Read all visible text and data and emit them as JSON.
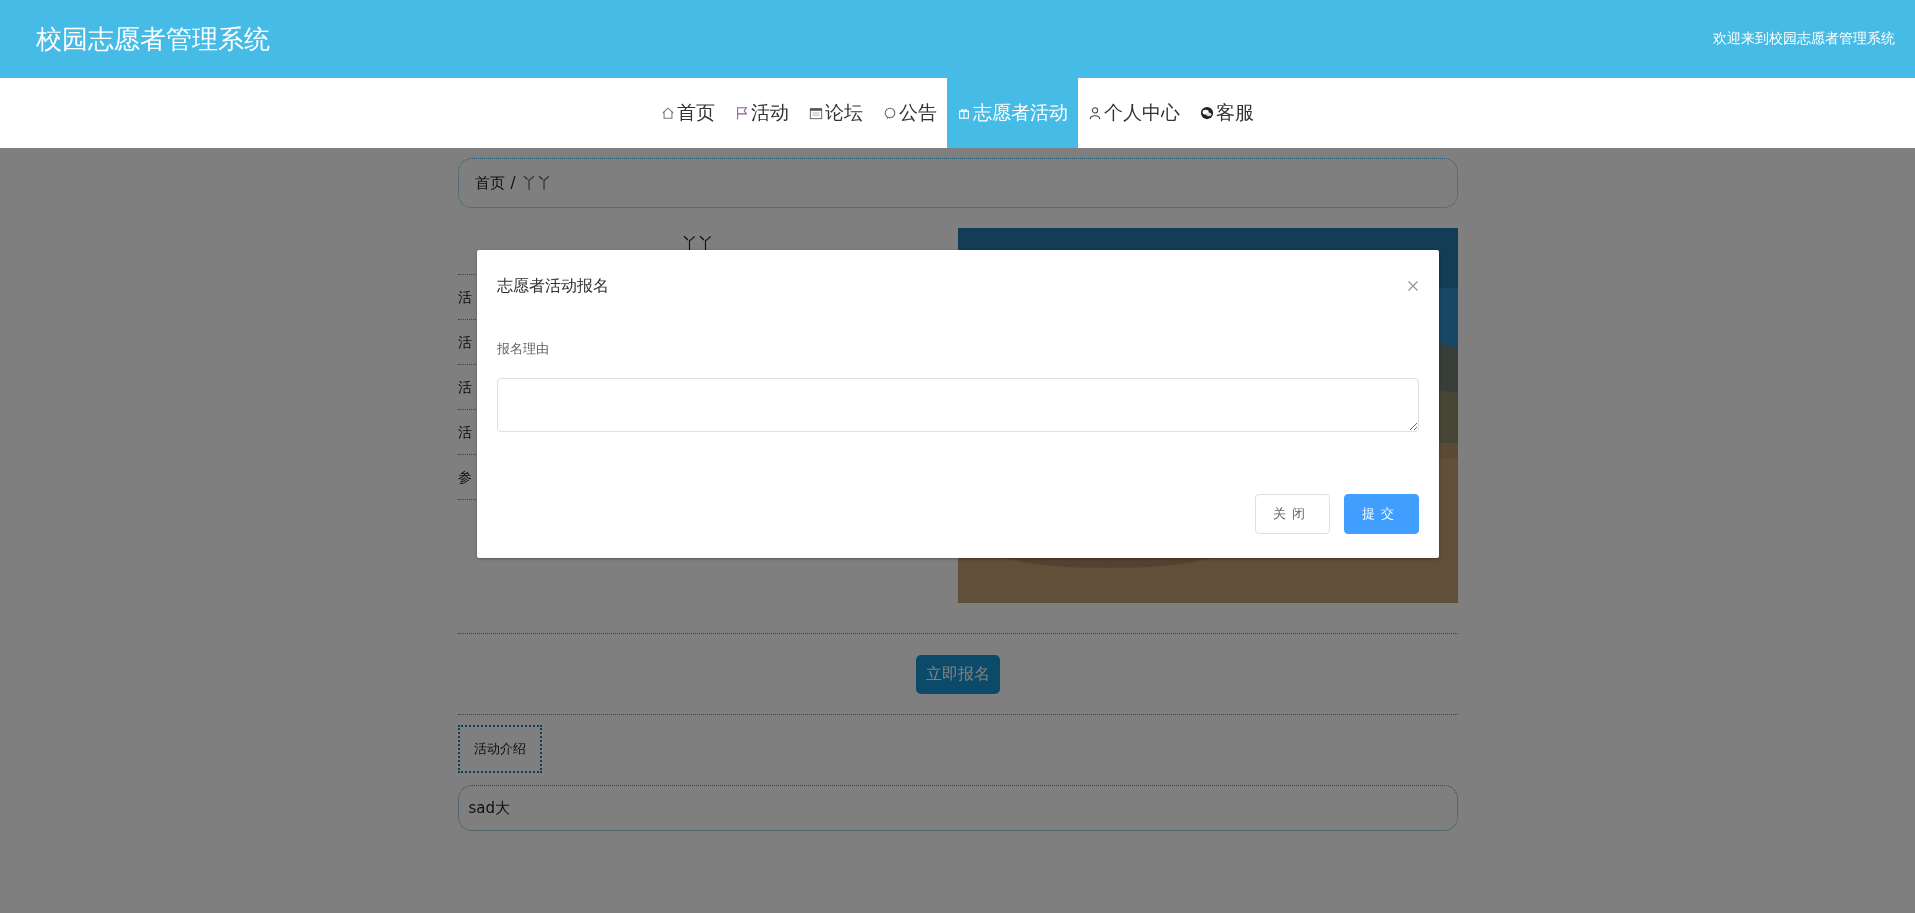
{
  "header": {
    "title": "校园志愿者管理系统",
    "welcome": "欢迎来到校园志愿者管理系统"
  },
  "nav": [
    {
      "label": "首页",
      "kind": "home",
      "selected": false
    },
    {
      "label": "活动",
      "kind": "flag",
      "selected": false
    },
    {
      "label": "论坛",
      "kind": "calendar",
      "selected": false
    },
    {
      "label": "公告",
      "kind": "bubble",
      "selected": false
    },
    {
      "label": "志愿者活动",
      "kind": "gift",
      "selected": true
    },
    {
      "label": "个人中心",
      "kind": "person",
      "selected": false
    },
    {
      "label": "客服",
      "kind": "chat",
      "selected": false
    }
  ],
  "breadcrumb": {
    "home": "首页",
    "separator": "/",
    "current": "丫丫"
  },
  "activity": {
    "title": "丫丫",
    "fields": [
      "活",
      "活",
      "活",
      "活",
      "参"
    ]
  },
  "signup_button": "立即报名",
  "tabs": [
    {
      "label": "活动介绍",
      "selected": true
    }
  ],
  "intro": "sad大",
  "dialog": {
    "title": "志愿者活动报名",
    "field_label": "报名理由",
    "buttons": [
      {
        "label": "关闭",
        "kind": "default"
      },
      {
        "label": "提交",
        "kind": "primary"
      }
    ]
  }
}
